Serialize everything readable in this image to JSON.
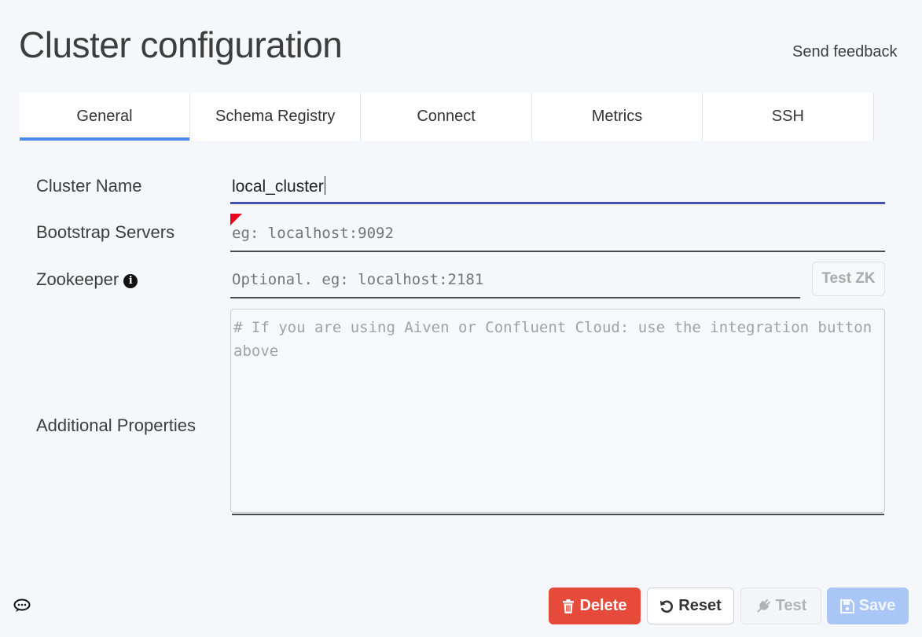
{
  "page": {
    "title": "Cluster configuration",
    "feedback_label": "Send feedback"
  },
  "tabs": [
    {
      "label": "General",
      "active": true
    },
    {
      "label": "Schema Registry",
      "active": false
    },
    {
      "label": "Connect",
      "active": false
    },
    {
      "label": "Metrics",
      "active": false
    },
    {
      "label": "SSH",
      "active": false
    }
  ],
  "form": {
    "cluster_name": {
      "label": "Cluster Name",
      "value": "local_cluster"
    },
    "bootstrap_servers": {
      "label": "Bootstrap Servers",
      "value": "",
      "placeholder": "eg: localhost:9092"
    },
    "zookeeper": {
      "label": "Zookeeper",
      "value": "",
      "placeholder": "Optional. eg: localhost:2181",
      "test_label": "Test ZK"
    },
    "additional_properties": {
      "label": "Additional Properties",
      "placeholder": "# If you are using Aiven or Confluent Cloud: use the integration button above"
    }
  },
  "actions": {
    "delete_label": "Delete",
    "reset_label": "Reset",
    "test_label": "Test",
    "save_label": "Save"
  },
  "colors": {
    "accent": "#4d8af0",
    "danger": "#e64a3a",
    "save_disabled": "#a9c6f7",
    "error_flag": "#e8001c"
  }
}
